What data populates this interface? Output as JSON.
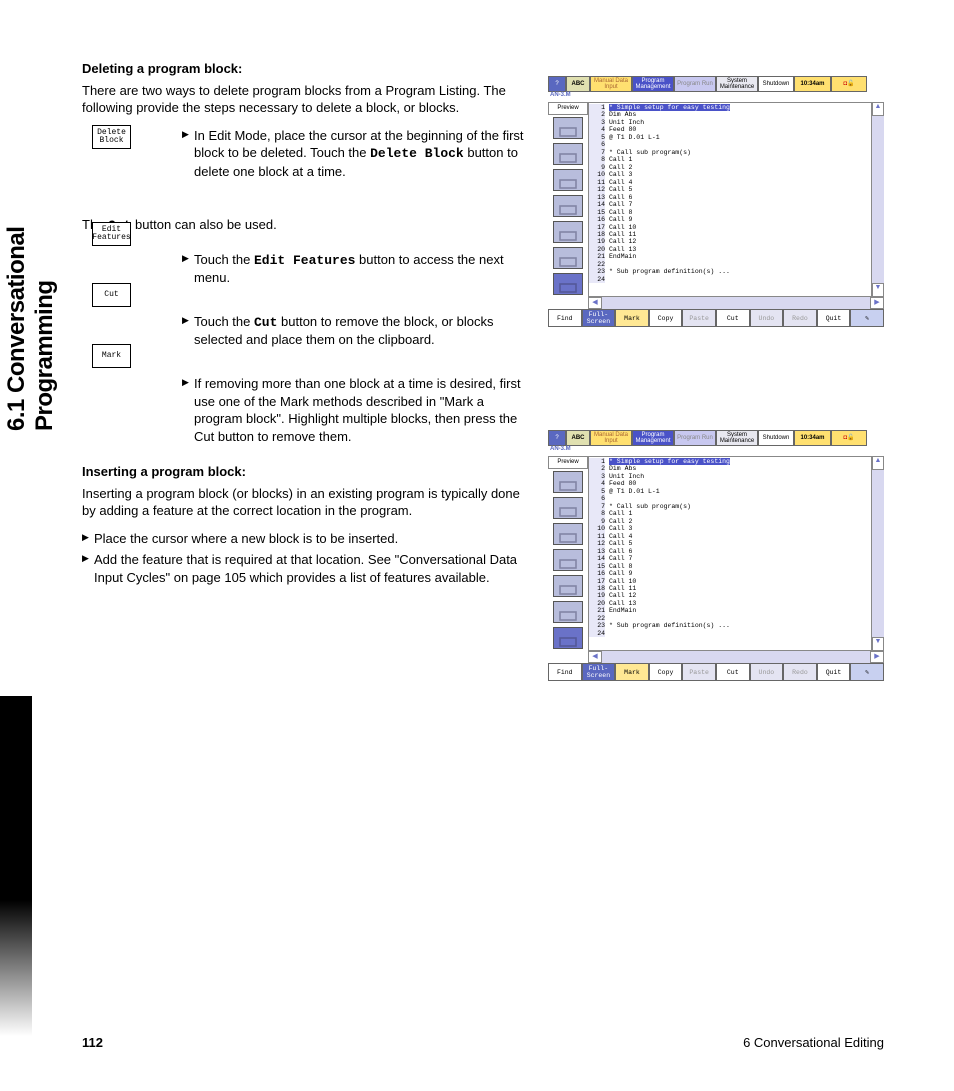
{
  "section_tab": "6.1 Conversational Programming",
  "h1": "Deleting a program block:",
  "p1": "There are two ways to delete program blocks from a Program Listing. The following provide the steps necessary to delete a block, or blocks.",
  "b1a": "In Edit Mode, place the cursor at the beginning of the first block to be deleted.  Touch the ",
  "b1b": "Delete Block",
  "b1c": " button to delete one block at a time.",
  "p2a": "The ",
  "p2b": "Cut",
  "p2c": " button can also be used.",
  "b2a": "Touch the ",
  "b2b": "Edit Features",
  "b2c": " button to access the next menu.",
  "b3a": "Touch the ",
  "b3b": "Cut",
  "b3c": " button to remove the block, or blocks selected and place them on the clipboard.",
  "b4": "If removing more than one block at a time is desired, first use one of the Mark methods described in \"Mark a program block\". Highlight multiple blocks, then press the Cut button to remove them.",
  "h2": "Inserting a program block:",
  "p3": "Inserting a program block (or blocks) in an existing program is typically done by adding a feature at the correct location in the program.",
  "b5": "Place the cursor where a new block is to be  inserted.",
  "b6": "Add the feature that is required at that location. See \"Conversational Data Input Cycles\" on page 105 which provides a list of features available.",
  "btn_delete": "Delete\nBlock",
  "btn_editf": "Edit\nFeatures",
  "btn_cut_side": "Cut",
  "btn_mark_side": "Mark",
  "footer_page": "112",
  "footer_chapter": "6 Conversational Editing",
  "ui": {
    "tabs": {
      "help": "?",
      "abc": "ABC",
      "mdi": "Manual Data\nInput",
      "pm": "Program\nManagement",
      "pr": "Program Run",
      "sm": "System\nMaintenance",
      "sd": "Shutdown",
      "time": "10:34am"
    },
    "progname": "AN-3.M",
    "preview": "Preview",
    "code": [
      {
        "n": "1",
        "t": "* Simple setup for easy testing",
        "hl": true
      },
      {
        "n": "2",
        "t": "Dim Abs"
      },
      {
        "n": "3",
        "t": "Unit Inch"
      },
      {
        "n": "4",
        "t": "Feed 80"
      },
      {
        "n": "5",
        "t": "@ T1 D.01 L-1"
      },
      {
        "n": "6",
        "t": ""
      },
      {
        "n": "7",
        "t": "* Call sub program(s)"
      },
      {
        "n": "8",
        "t": "Call 1"
      },
      {
        "n": "9",
        "t": "Call 2"
      },
      {
        "n": "10",
        "t": "Call 3"
      },
      {
        "n": "11",
        "t": "Call 4"
      },
      {
        "n": "12",
        "t": "Call 5"
      },
      {
        "n": "13",
        "t": "Call 6"
      },
      {
        "n": "14",
        "t": "Call 7"
      },
      {
        "n": "15",
        "t": "Call 8"
      },
      {
        "n": "16",
        "t": "Call 9"
      },
      {
        "n": "17",
        "t": "Call 10"
      },
      {
        "n": "18",
        "t": "Call 11"
      },
      {
        "n": "19",
        "t": "Call 12"
      },
      {
        "n": "20",
        "t": "Call 13"
      },
      {
        "n": "21",
        "t": "EndMain"
      },
      {
        "n": "22",
        "t": ""
      },
      {
        "n": "23",
        "t": "* Sub program definition(s) ..."
      },
      {
        "n": "24",
        "t": ""
      }
    ],
    "bottom": {
      "find": "Find",
      "full": "Full-\nScreen",
      "mark": "Mark",
      "copy": "Copy",
      "paste": "Paste",
      "cut": "Cut",
      "undo": "Undo",
      "redo": "Redo",
      "quit": "Quit"
    }
  }
}
